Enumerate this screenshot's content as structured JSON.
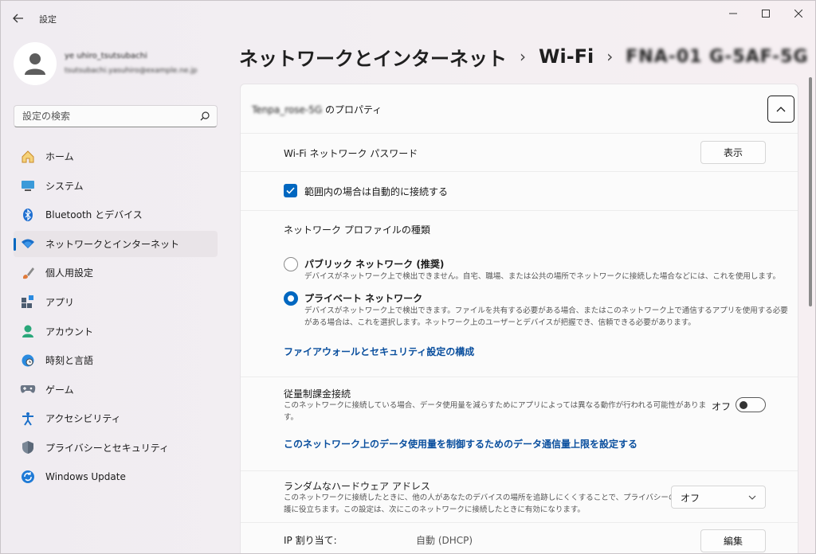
{
  "app": {
    "title": "設定"
  },
  "profile": {
    "name": "ye uhiro_tsutsubachi",
    "email": "tsutsubachi.yasuhiro@example.ne.jp"
  },
  "search": {
    "placeholder": "設定の検索"
  },
  "sidebar": {
    "items": [
      {
        "label": "ホーム",
        "icon": "home-icon"
      },
      {
        "label": "システム",
        "icon": "system-icon"
      },
      {
        "label": "Bluetooth とデバイス",
        "icon": "bluetooth-icon"
      },
      {
        "label": "ネットワークとインターネット",
        "icon": "wifi-icon",
        "active": true
      },
      {
        "label": "個人用設定",
        "icon": "brush-icon"
      },
      {
        "label": "アプリ",
        "icon": "apps-icon"
      },
      {
        "label": "アカウント",
        "icon": "account-icon"
      },
      {
        "label": "時刻と言語",
        "icon": "globe-clock-icon"
      },
      {
        "label": "ゲーム",
        "icon": "gamepad-icon"
      },
      {
        "label": "アクセシビリティ",
        "icon": "accessibility-icon"
      },
      {
        "label": "プライバシーとセキュリティ",
        "icon": "shield-icon"
      },
      {
        "label": "Windows Update",
        "icon": "update-icon"
      }
    ]
  },
  "breadcrumb": {
    "level1": "ネットワークとインターネット",
    "level2": "Wi-Fi",
    "level3": "FNA-01 G-5AF-5G"
  },
  "properties": {
    "ssid": "Tenpa_rose-5G",
    "title_suffix": "のプロパティ",
    "password_label": "Wi-Fi ネットワーク パスワード",
    "show_button": "表示",
    "auto_connect_label": "範囲内の場合は自動的に接続する",
    "auto_connect_checked": true,
    "profile_type_heading": "ネットワーク プロファイルの種類",
    "public_title": "パブリック ネットワーク (推奨)",
    "public_desc": "デバイスがネットワーク上で検出できません。自宅、職場、または公共の場所でネットワークに接続した場合などには、これを使用します。",
    "private_title": "プライベート ネットワーク",
    "private_desc1": "デバイスがネットワーク上で検出できます。ファイルを共有する必要がある場合、またはこのネットワーク上で通信するアプリを使用する必要",
    "private_desc2": "がある場合は、これを選択します。ネットワーク上のユーザーとデバイスが把握でき、信頼できる必要があります。",
    "selected_profile": "private",
    "firewall_link": "ファイアウォールとセキュリティ設定の構成",
    "metered_label": "従量制課金接続",
    "metered_desc1": "このネットワークに接続している場合、データ使用量を減らすためにアプリによっては異なる動作が行われる可能性がありま",
    "metered_desc2": "す。",
    "metered_state": "オフ",
    "data_limit_link": "このネットワーク上のデータ使用量を制御するためのデータ通信量上限を設定する",
    "random_hw_label": "ランダムなハードウェア アドレス",
    "random_hw_desc1": "このネットワークに接続したときに、他の人があなたのデバイスの場所を追跡しにくくすることで、プライバシーの保",
    "random_hw_desc2": "護に役立ちます。この設定は、次にこのネットワークに接続したときに有効になります。",
    "random_hw_value": "オフ",
    "ip_label": "IP 割り当て:",
    "ip_value": "自動 (DHCP)",
    "edit_button": "編集"
  },
  "colors": {
    "accent": "#0067c0",
    "link": "#0a4f9e"
  }
}
